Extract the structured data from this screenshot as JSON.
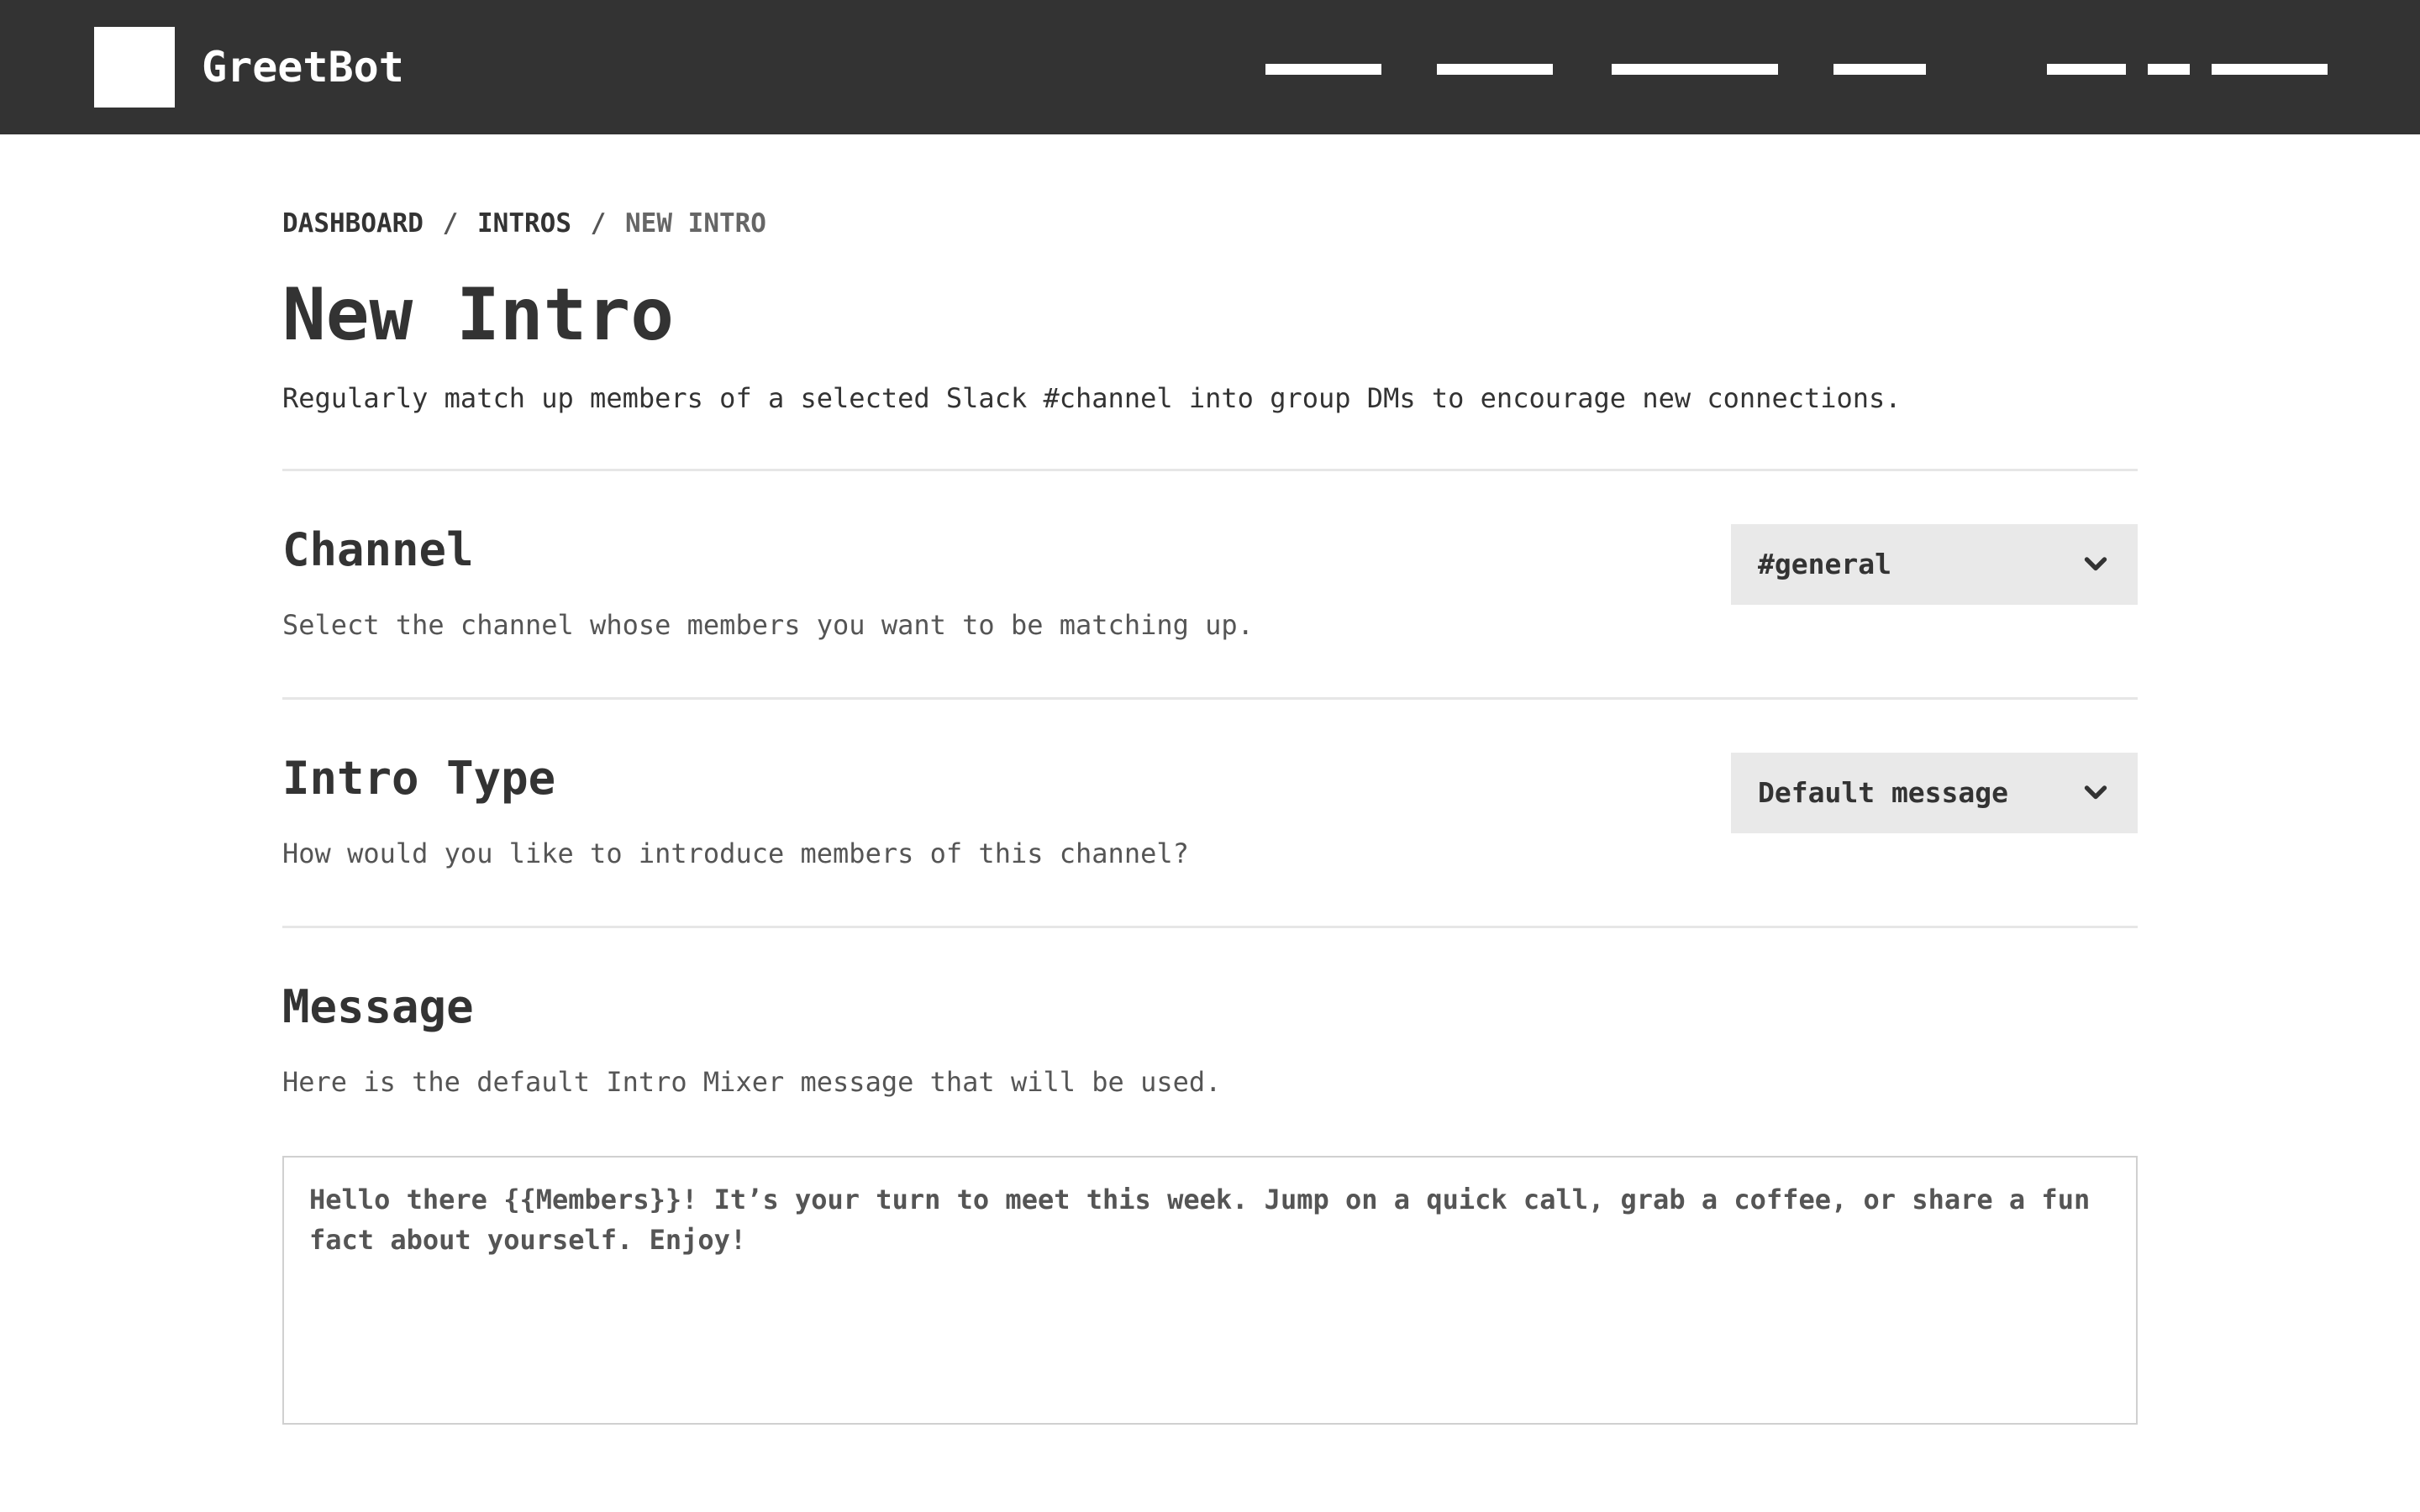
{
  "app": {
    "name": "GreetBot"
  },
  "breadcrumb": {
    "items": [
      "DASHBOARD",
      "INTROS",
      "NEW INTRO"
    ],
    "separator": "/"
  },
  "page": {
    "title": "New Intro",
    "description": "Regularly match up members of a selected Slack #channel into group DMs to encourage new connections."
  },
  "sections": {
    "channel": {
      "title": "Channel",
      "description": "Select the channel whose members you want to be matching up.",
      "selected": "#general"
    },
    "intro_type": {
      "title": "Intro Type",
      "description": "How would you like to introduce members of this channel?",
      "selected": "Default message"
    },
    "message": {
      "title": "Message",
      "description": "Here is the default Intro Mixer message that will be used.",
      "value": "Hello there {{Members}}! It’s your turn to meet this week. Jump on a quick call, grab a coffee, or share a fun fact about yourself. Enjoy!"
    }
  },
  "colors": {
    "topbar": "#333333",
    "text": "#333333",
    "muted": "#555555",
    "select_bg": "#e9e9e9",
    "divider": "#e6e6e6"
  },
  "icons": {
    "select_arrow": "chevron-down-icon"
  }
}
